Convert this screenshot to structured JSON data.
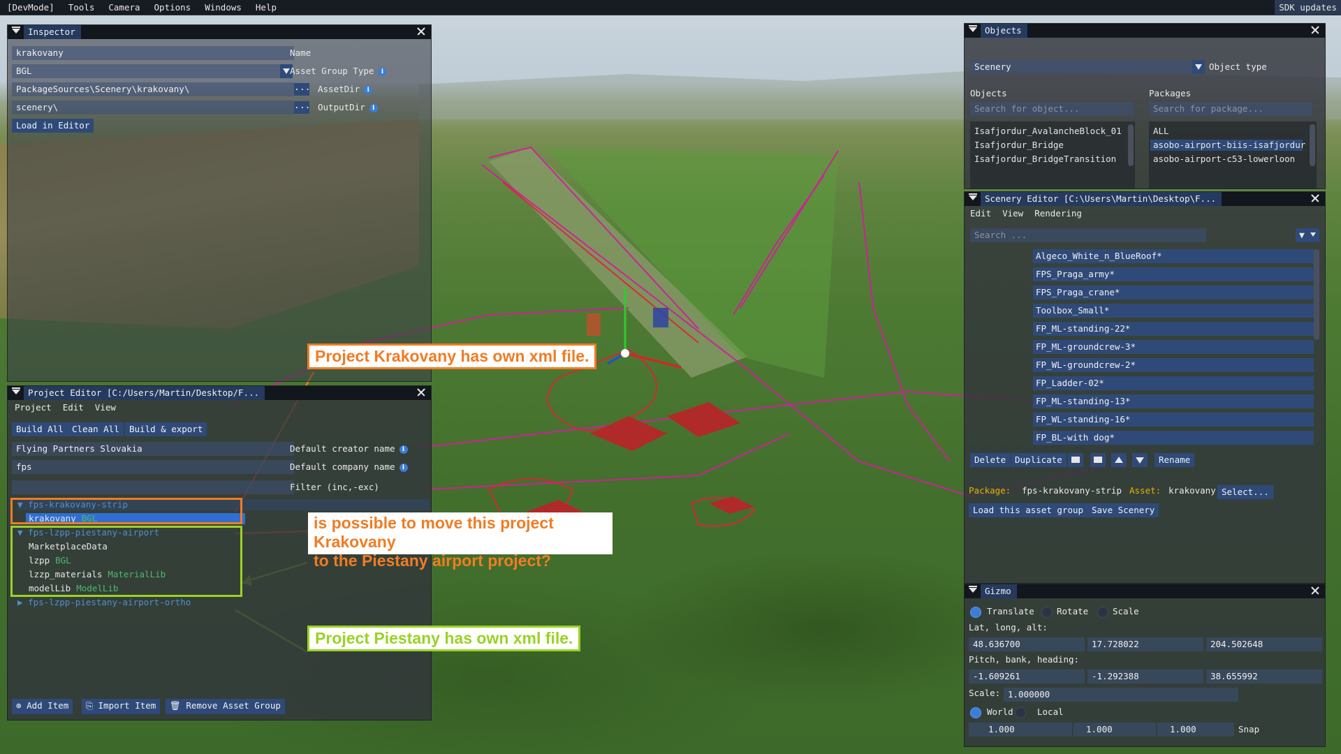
{
  "menubar": {
    "items": [
      "[DevMode]",
      "Tools",
      "Camera",
      "Options",
      "Windows",
      "Help"
    ],
    "sdk_updates": "SDK updates"
  },
  "inspector": {
    "title": "Inspector",
    "name_value": "krakovany",
    "name_label": "Name",
    "asset_group_type_value": "BGL",
    "asset_group_type_label": "Asset Group Type",
    "asset_dir_value": "PackageSources\\Scenery\\krakovany\\",
    "asset_dir_label": "AssetDir",
    "output_dir_value": "scenery\\",
    "output_dir_label": "OutputDir",
    "load_button": "Load in Editor",
    "dots": "..."
  },
  "project_editor": {
    "title": "Project Editor [C:/Users/Martin/Desktop/F...",
    "menu": [
      "Project",
      "Edit",
      "View"
    ],
    "buttons": [
      "Build All",
      "Clean All",
      "Build & export"
    ],
    "creator_value": "Flying Partners Slovakia",
    "creator_label": "Default creator name",
    "company_value": "fps",
    "company_label": "Default company name",
    "filter_label": "Filter (inc,-exc)",
    "tree": {
      "group1": "fps-krakovany-strip",
      "group1_item": "krakovany",
      "group1_item_tag": "BGL",
      "group2": "fps-lzpp-piestany-airport",
      "group2_items": [
        {
          "name": "MarketplaceData",
          "tag": ""
        },
        {
          "name": "lzpp",
          "tag": "BGL"
        },
        {
          "name": "lzzp_materials",
          "tag": "MaterialLib"
        },
        {
          "name": "modelLib",
          "tag": "ModelLib"
        }
      ],
      "group3": "fps-lzpp-piestany-airport-ortho"
    },
    "bottom_buttons": [
      "Add Item",
      "Import Item",
      "Remove Asset Group"
    ]
  },
  "objects": {
    "title": "Objects",
    "type_value": "Scenery",
    "type_label": "Object type",
    "objects_header": "Objects",
    "packages_header": "Packages",
    "objects_search_placeholder": "Search for object...",
    "packages_search_placeholder": "Search for package...",
    "objects_list": [
      "Isafjordur_AvalancheBlock_01",
      "Isafjordur_Bridge",
      "Isafjordur_BridgeTransition"
    ],
    "packages_list": [
      "ALL",
      "asobo-airport-biis-isafjordur",
      "asobo-airport-c53-lowerloon"
    ]
  },
  "scenery_editor": {
    "title": "Scenery Editor [C:\\Users\\Martin\\Desktop\\F...",
    "menu": [
      "Edit",
      "View",
      "Rendering"
    ],
    "search_placeholder": "Search ...",
    "items": [
      "Algeco_White_n_BlueRoof*",
      "FPS_Praga_army*",
      "FPS_Praga_crane*",
      "Toolbox_Small*",
      "FP_ML-standing-22*",
      "FP_ML-groundcrew-3*",
      "FP_WL-groundcrew-2*",
      "FP_Ladder-02*",
      "FP_ML-standing-13*",
      "FP_WL-standing-16*",
      "FP_BL-with dog*"
    ],
    "action_delete": "Delete",
    "action_duplicate": "Duplicate",
    "action_rename": "Rename",
    "package_label": "Package:",
    "package_value": "fps-krakovany-strip",
    "asset_label": "Asset:",
    "asset_value": "krakovany",
    "select_button": "Select...",
    "load_group_button": "Load this asset group",
    "save_button": "Save Scenery"
  },
  "gizmo": {
    "title": "Gizmo",
    "modes": [
      "Translate",
      "Rotate",
      "Scale"
    ],
    "latlongalt_label": "Lat, long, alt:",
    "lat": "48.636700",
    "long": "17.728022",
    "alt": "204.502648",
    "pbh_label": "Pitch, bank, heading:",
    "pitch": "-1.609261",
    "bank": "-1.292388",
    "heading": "38.655992",
    "scale_label": "Scale:",
    "scale_value": "1.000000",
    "space_world": "World",
    "space_local": "Local",
    "snap_values": [
      "1.000",
      "1.000",
      "1.000"
    ],
    "snap_label": "Snap"
  },
  "annotations": {
    "krakovany_note": "Project Krakovany has own xml file.",
    "question_line1": "is possible to move this project Krakovany",
    "question_line2": "to the Piestany airport project?",
    "piestany_note": "Project Piestany has own xml file."
  },
  "colors": {
    "accent_orange": "#f07c24",
    "accent_green": "#9ad225",
    "title_blue": "#253a5e",
    "button_blue": "#2f4a78",
    "selection_blue": "#2f6fd1",
    "wire_magenta": "#d11f9a"
  }
}
